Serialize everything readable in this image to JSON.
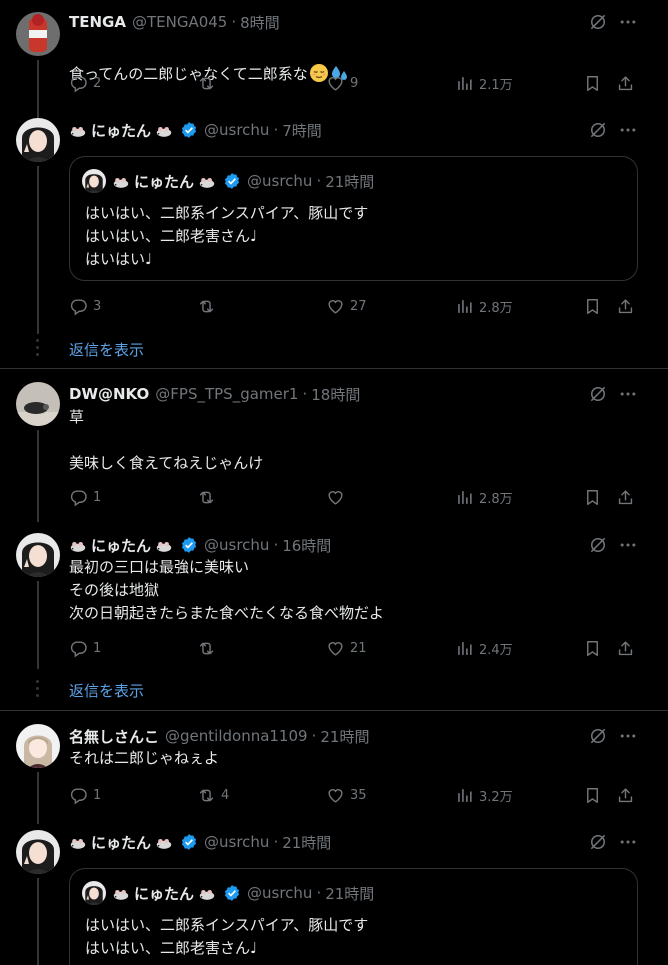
{
  "tweets": [
    {
      "name": "TENGA",
      "handle": "@TENGA045",
      "time": "8時間",
      "text": "食ってんの二郎じゃなくて二郎系な",
      "reply": "2",
      "retweet": "",
      "like": "9",
      "views": "2.1万"
    },
    {
      "name": "にゅたん",
      "handle": "@usrchu",
      "time": "7時間",
      "text": "",
      "reply": "3",
      "retweet": "",
      "like": "27",
      "views": "2.8万",
      "quote": {
        "name": "にゅたん",
        "handle": "@usrchu",
        "time": "21時間",
        "text": "はいはい、二郎系インスパイア、豚山です\nはいはい、二郎老害さん♩\nはいはい♩"
      }
    },
    {
      "name": "DW@NKO",
      "handle": "@FPS_TPS_gamer1",
      "time": "18時間",
      "text": "草\n\n美味しく食えてねえじゃんけ",
      "reply": "1",
      "retweet": "",
      "like": "",
      "views": "2.8万"
    },
    {
      "name": "にゅたん",
      "handle": "@usrchu",
      "time": "16時間",
      "text": "最初の三口は最強に美味い\nその後は地獄\n次の日朝起きたらまた食べたくなる食べ物だよ",
      "reply": "1",
      "retweet": "",
      "like": "21",
      "views": "2.4万"
    },
    {
      "name": "名無しさんこ",
      "handle": "@gentildonna1109",
      "time": "21時間",
      "text": "それは二郎じゃねぇよ",
      "reply": "1",
      "retweet": "4",
      "like": "35",
      "views": "3.2万"
    },
    {
      "name": "にゅたん",
      "handle": "@usrchu",
      "time": "21時間",
      "text": "",
      "quote": {
        "name": "にゅたん",
        "handle": "@usrchu",
        "time": "21時間",
        "text": "はいはい、二郎系インスパイア、豚山です\nはいはい、二郎老害さん♩"
      }
    }
  ],
  "show_replies": "返信を表示",
  "separator": "·",
  "colors": {
    "background": "#000000",
    "text": "#e7e9ea",
    "muted": "#71767b",
    "link": "#5da2e6",
    "verified": "#1d9bf0",
    "border": "#2f3336"
  }
}
